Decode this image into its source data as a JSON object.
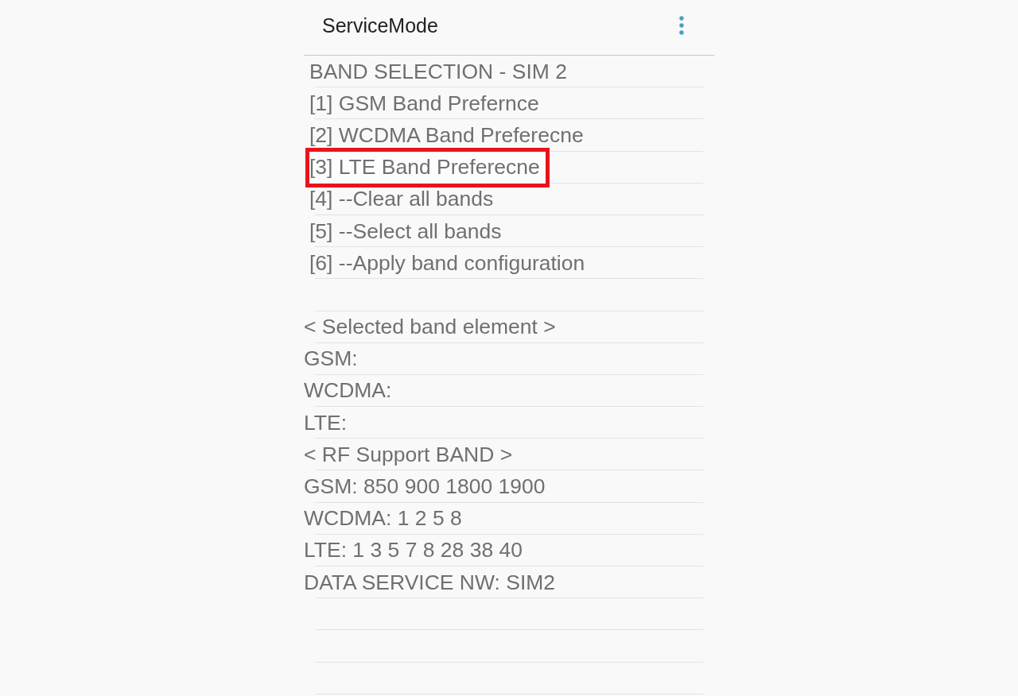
{
  "app_bar": {
    "title": "ServiceMode"
  },
  "band_selection": {
    "title": "BAND SELECTION - SIM 2",
    "options": [
      {
        "label": "[1] GSM Band Prefernce",
        "highlighted": false
      },
      {
        "label": "[2] WCDMA Band Preferecne",
        "highlighted": false
      },
      {
        "label": "[3] LTE Band Preferecne",
        "highlighted": true
      },
      {
        "label": "[4] --Clear all bands",
        "highlighted": false
      },
      {
        "label": "[5] --Select all bands",
        "highlighted": false
      },
      {
        "label": "[6] --Apply band configuration",
        "highlighted": false
      }
    ]
  },
  "info_rows": [
    {
      "kind": "blank"
    },
    {
      "kind": "text",
      "text": "< Selected band element >"
    },
    {
      "kind": "text",
      "text": "GSM:"
    },
    {
      "kind": "text",
      "text": "WCDMA:"
    },
    {
      "kind": "text",
      "text": "LTE:"
    },
    {
      "kind": "text",
      "text": "< RF Support BAND >"
    },
    {
      "kind": "text",
      "text": "GSM: 850 900 1800 1900"
    },
    {
      "kind": "text",
      "text": "WCDMA: 1 2 5 8"
    },
    {
      "kind": "text",
      "text": "LTE: 1 3 5 7 8 28 38 40"
    },
    {
      "kind": "text",
      "text": "DATA SERVICE NW: SIM2"
    },
    {
      "kind": "blank"
    },
    {
      "kind": "blank"
    },
    {
      "kind": "blank"
    }
  ]
}
